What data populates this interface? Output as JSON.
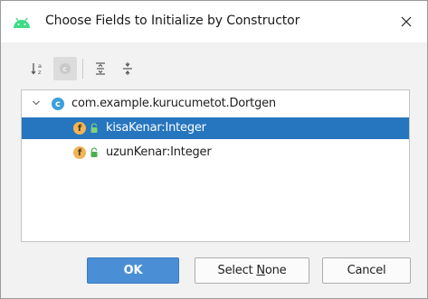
{
  "window": {
    "title": "Choose Fields to Initialize by Constructor",
    "app_icon": "android-icon",
    "close_icon": "close-icon"
  },
  "toolbar": {
    "items": [
      {
        "icon": "sort-alphabetically-icon",
        "active": false
      },
      {
        "icon": "class-filter-icon",
        "active": true
      },
      {
        "icon": "expand-all-icon",
        "active": false
      },
      {
        "icon": "collapse-all-icon",
        "active": false
      }
    ]
  },
  "tree": {
    "root": {
      "label": "com.example.kurucumetot.Dortgen",
      "icon": "class-icon",
      "icon_letter": "c",
      "expanded": true
    },
    "fields": [
      {
        "label": "kisaKenar:Integer",
        "icon_letter": "f",
        "selected": true
      },
      {
        "label": "uzunKenar:Integer",
        "icon_letter": "f",
        "selected": false
      }
    ]
  },
  "buttons": {
    "ok_label": "OK",
    "select_none_prefix": "Select ",
    "select_none_mnemonic": "N",
    "select_none_suffix": "one",
    "cancel_label": "Cancel"
  },
  "colors": {
    "selection": "#2675bf",
    "primary_button": "#4a8fd6",
    "android_green": "#3ddc84",
    "field_icon": "#f0b45a",
    "class_icon": "#3aa0d8",
    "lock_green": "#4caf50"
  }
}
